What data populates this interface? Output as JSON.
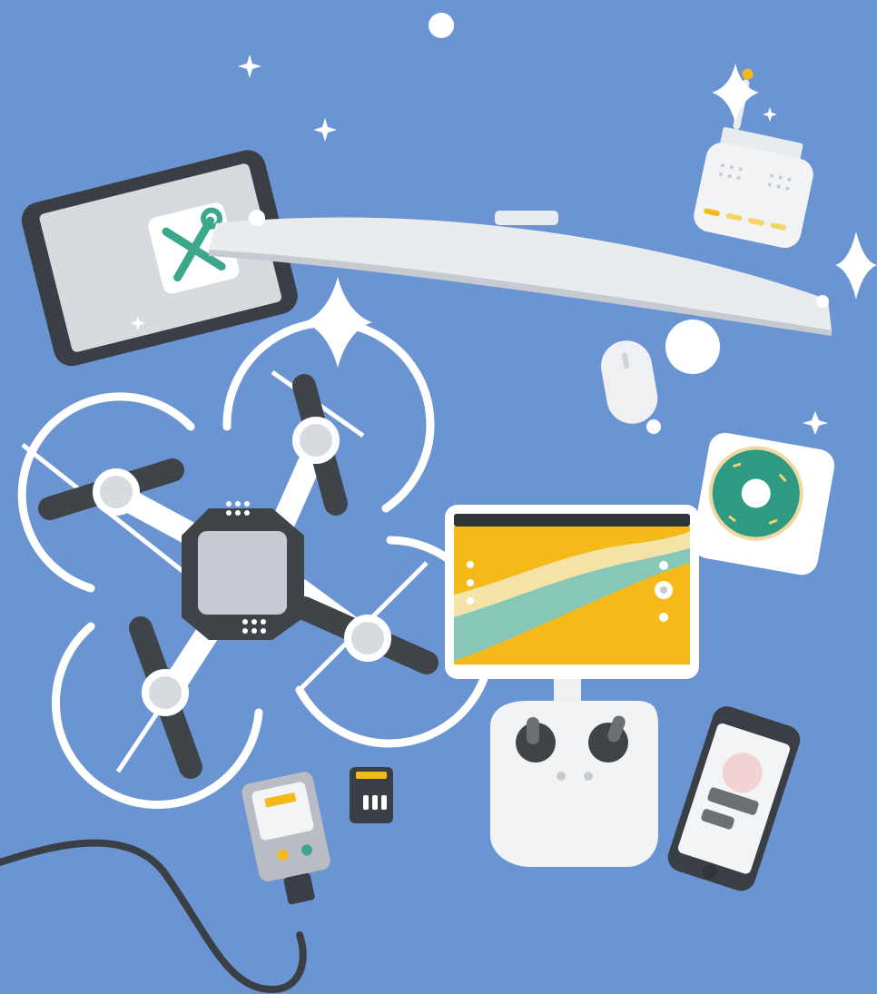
{
  "scene": {
    "description_free": true,
    "colors": {
      "background": "#6a95d2",
      "white": "#ffffff",
      "light_gray": "#d7dbe0",
      "mid_gray": "#b9bdc3",
      "dark_gray": "#3f4448",
      "frame_dark": "#3a3f45",
      "accent_yellow": "#f6b91a",
      "accent_teal": "#3ba88c",
      "river_cream": "#f3e3a6",
      "river_teal": "#86c7b8",
      "donut_green": "#2f9a82",
      "pink": "#f2d3d3"
    },
    "objects": [
      {
        "name": "tablet",
        "icon": "tools-icon"
      },
      {
        "name": "monitor"
      },
      {
        "name": "router"
      },
      {
        "name": "mouse"
      },
      {
        "name": "drone"
      },
      {
        "name": "tablet-on-controller"
      },
      {
        "name": "remote-controller"
      },
      {
        "name": "sticker-donut"
      },
      {
        "name": "smartphone"
      },
      {
        "name": "charger"
      },
      {
        "name": "sd-card"
      },
      {
        "name": "cable"
      }
    ]
  }
}
